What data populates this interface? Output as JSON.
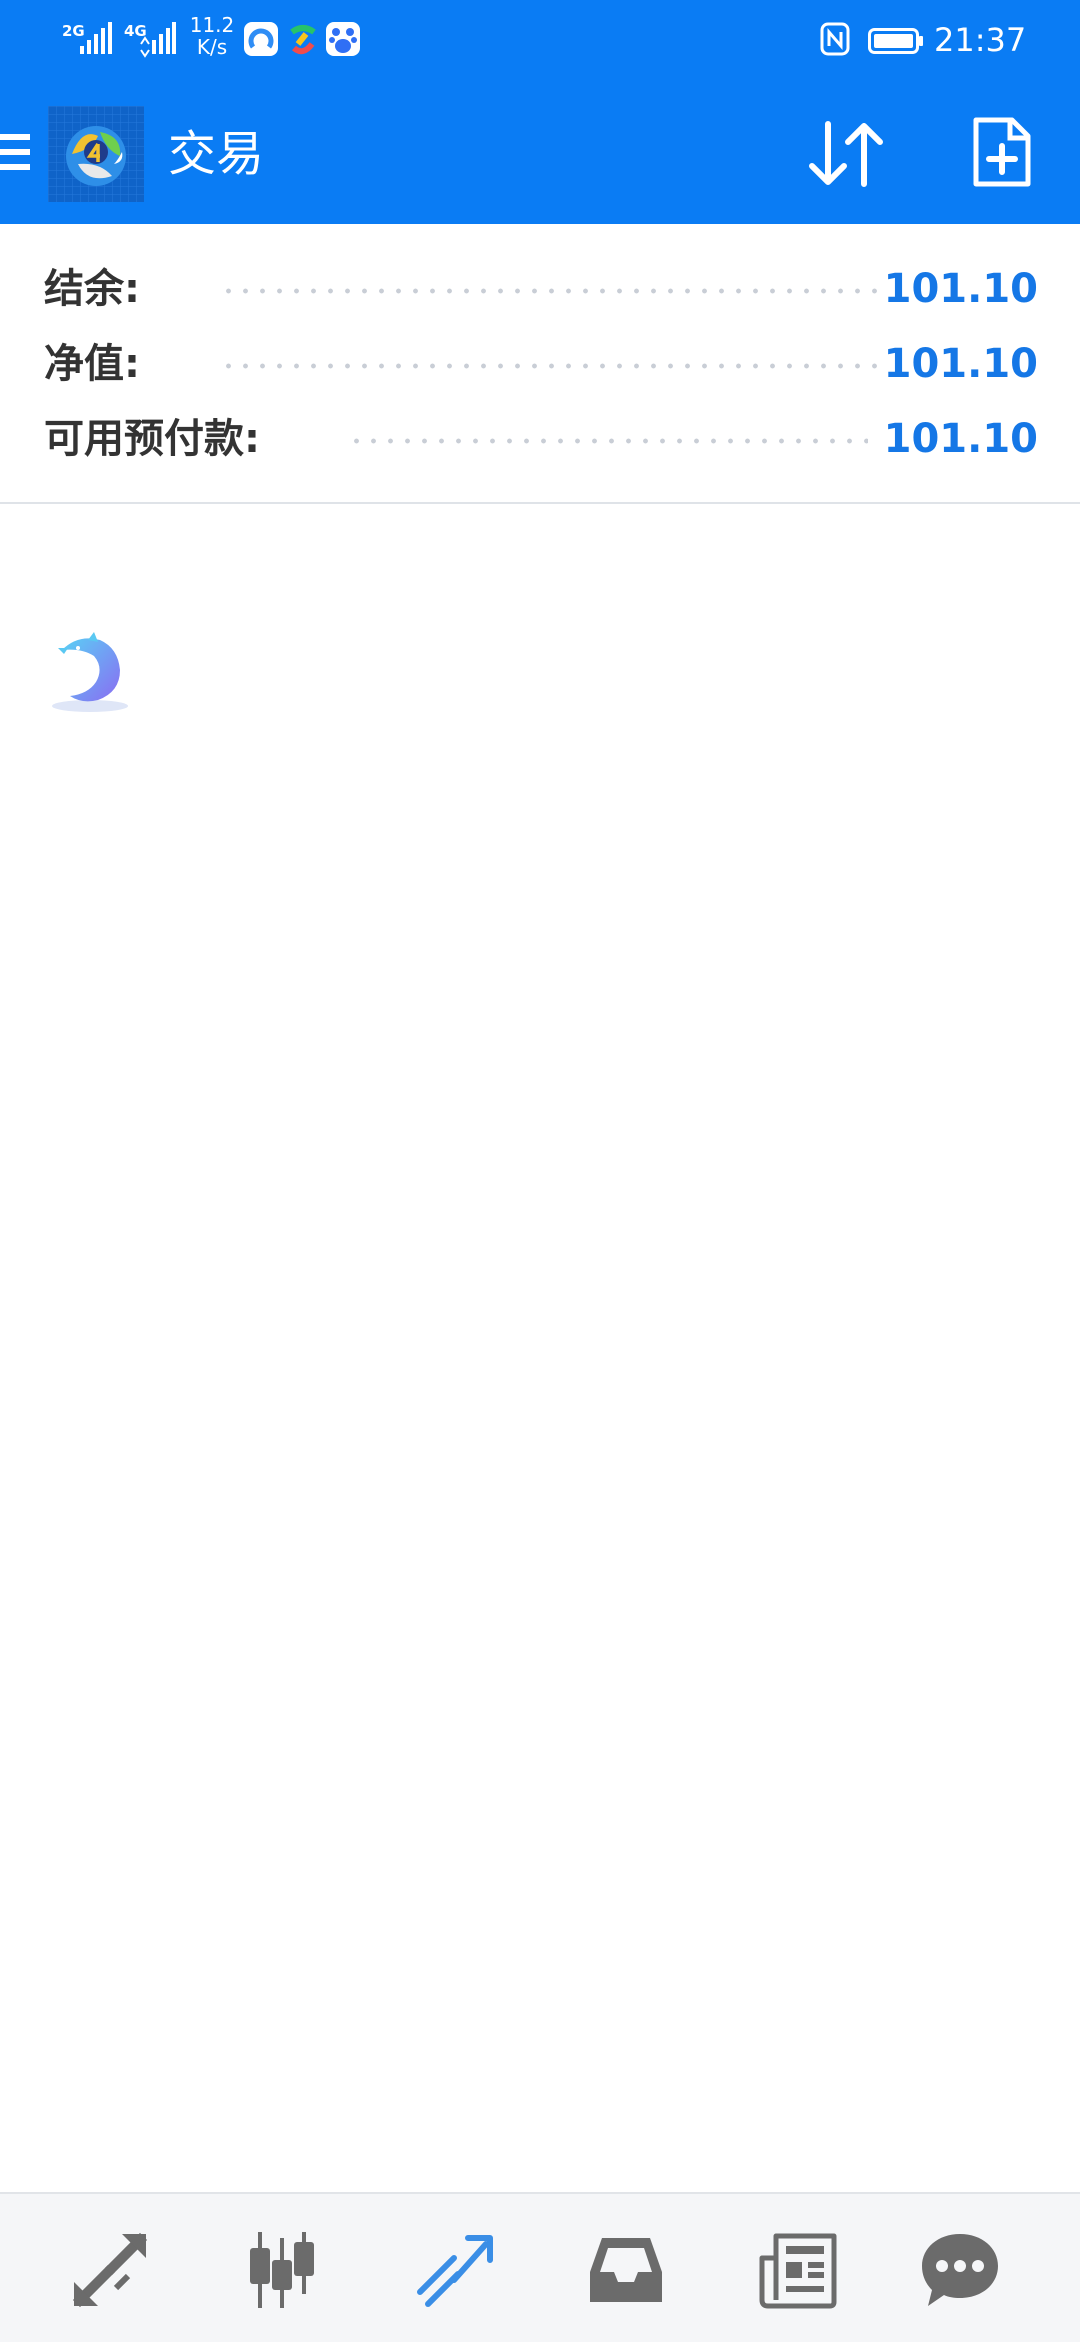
{
  "status_bar": {
    "signal_1_tag": "2G",
    "signal_2_tag": "4G",
    "net_speed_value": "11.2",
    "net_speed_unit": "K/s",
    "time": "21:37"
  },
  "app_bar": {
    "title": "交易"
  },
  "account_summary": {
    "rows": [
      {
        "label": "结余:",
        "value": "101.10"
      },
      {
        "label": "净值:",
        "value": "101.10"
      },
      {
        "label": "可用预付款:",
        "value": "101.10"
      }
    ]
  },
  "colors": {
    "primary": "#0a7cf4",
    "value_text": "#1577e6",
    "label_text": "#333333",
    "nav_icon": "#6b6b6b",
    "nav_icon_active": "#3a8ee6"
  },
  "bottom_nav": {
    "items": [
      {
        "icon": "quotes-arrows-icon",
        "active": false
      },
      {
        "icon": "candlestick-chart-icon",
        "active": false
      },
      {
        "icon": "trade-trend-icon",
        "active": true
      },
      {
        "icon": "history-inbox-icon",
        "active": false
      },
      {
        "icon": "news-icon",
        "active": false
      },
      {
        "icon": "messages-chat-icon",
        "active": false
      }
    ]
  }
}
